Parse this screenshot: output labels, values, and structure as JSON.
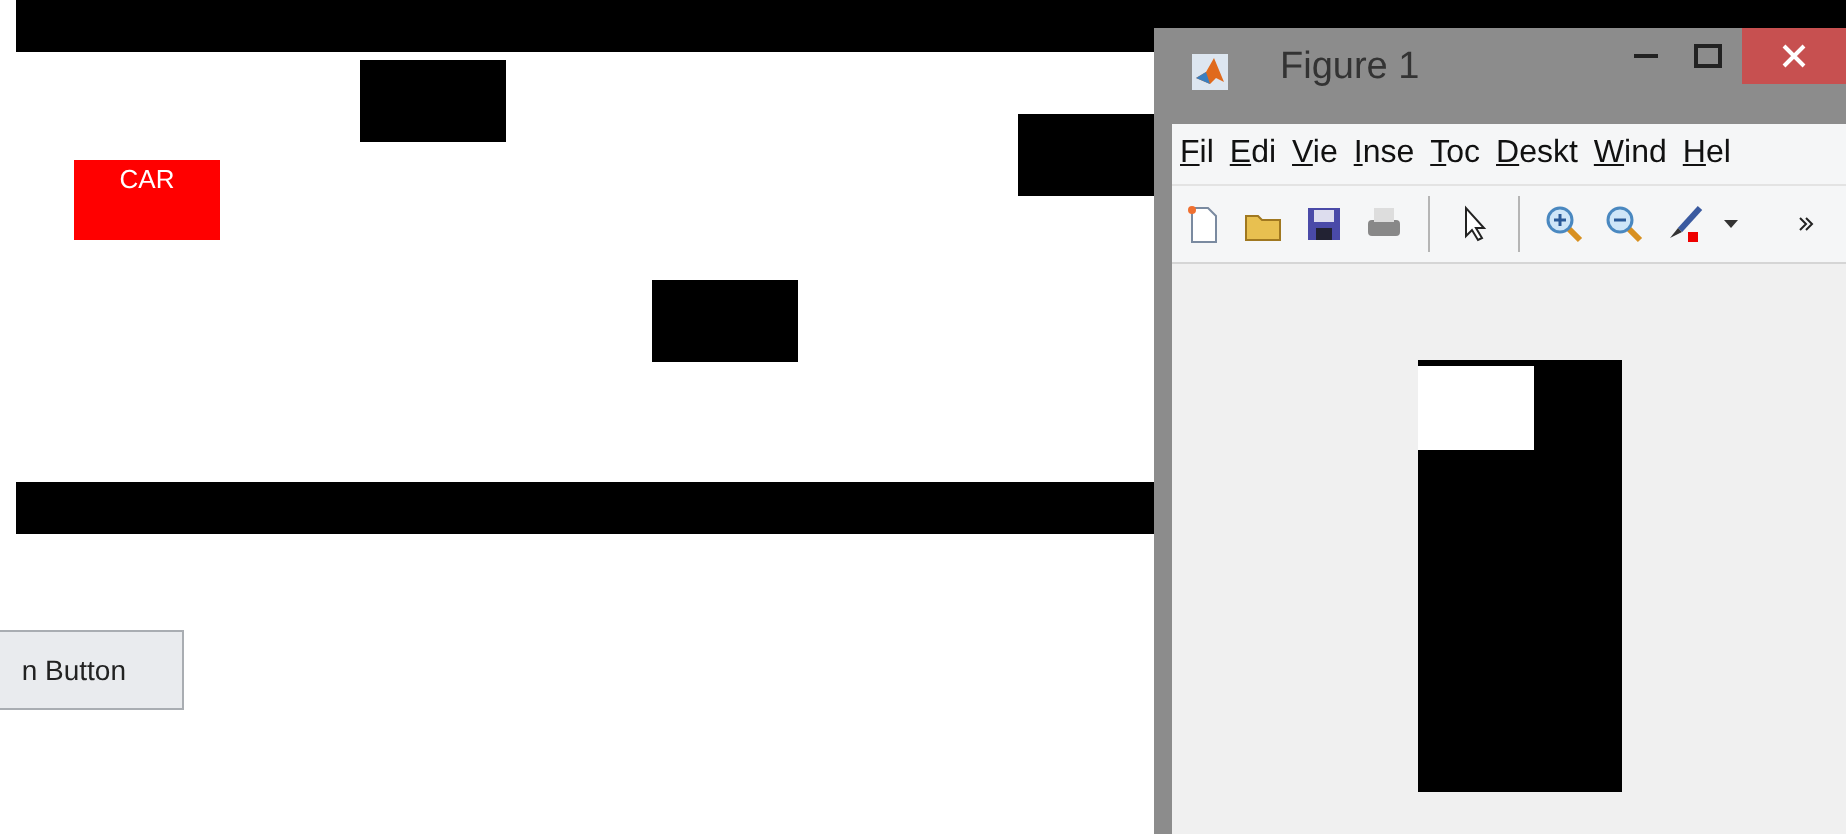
{
  "game": {
    "car": {
      "label": "CAR"
    },
    "button": {
      "label": "n Button"
    }
  },
  "figure": {
    "title": "Figure 1",
    "menus": [
      "Fil",
      "Edi",
      "Vie",
      "Inse",
      "Toc",
      "Deskt",
      "Wind",
      "Hel"
    ]
  }
}
